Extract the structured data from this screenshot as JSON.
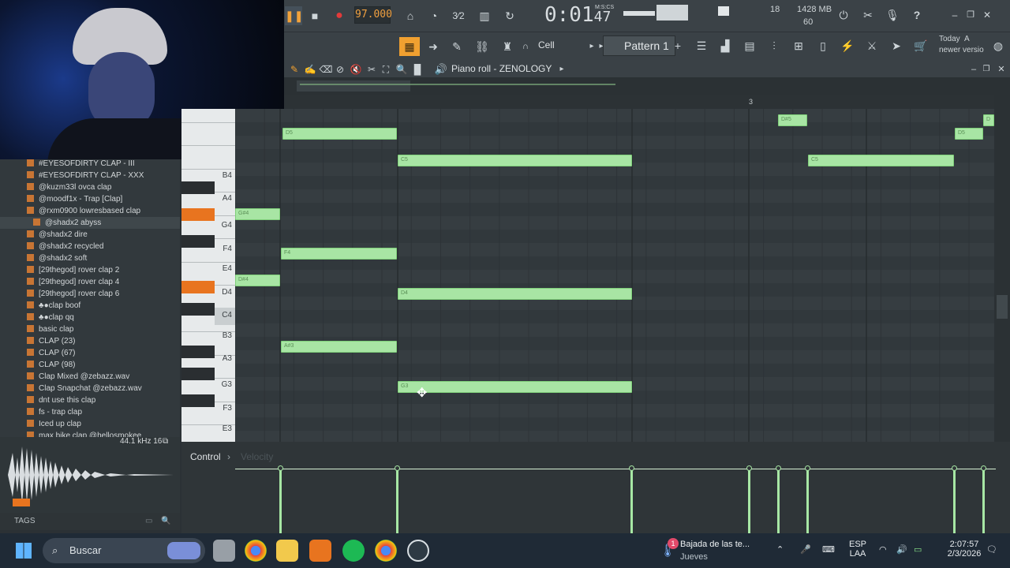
{
  "toolbar": {
    "tempo": "97.000",
    "time_main": "0:01",
    "time_sub": "47",
    "time_unit": "M:S:CS",
    "cpu": "18",
    "memory": "1428 MB",
    "polyphony": "60",
    "snap_label": "Cell",
    "pattern_label": "Pattern 1",
    "pattern_add": "+",
    "hint_today": "Today",
    "hint_msg": "newer versio",
    "hint_a": "A"
  },
  "piano_roll": {
    "title": "Piano roll - ZENOLOGY",
    "ruler_mark": "3",
    "keys": [
      "B4",
      "A4",
      "G4",
      "F4",
      "E4",
      "D4",
      "C4",
      "B3",
      "A3",
      "G3",
      "F3",
      "E3"
    ],
    "notes": [
      {
        "label": "D5"
      },
      {
        "label": "C5"
      },
      {
        "label": "D#5"
      },
      {
        "label": "C5"
      },
      {
        "label": "D5"
      },
      {
        "label": "D"
      },
      {
        "label": "G#4"
      },
      {
        "label": "F4"
      },
      {
        "label": "D#4"
      },
      {
        "label": "D4"
      },
      {
        "label": "A#3"
      },
      {
        "label": "G3"
      }
    ]
  },
  "control": {
    "label": "Control",
    "arrow": "›",
    "velocity_label": "Velocity"
  },
  "browser": {
    "items": [
      "#EYESOFDIRTY CLAP - III",
      "#EYESOFDIRTY CLAP - XXX",
      "@kuzm33l ovca clap",
      "@moodf1x - Trap [Clap]",
      "@rxm0900 lowresbased clap",
      "@shadx2 abyss",
      "@shadx2 dire",
      "@shadx2 recycled",
      "@shadx2 soft",
      "[29thegod] rover clap 2",
      "[29thegod] rover clap 4",
      "[29thegod] rover clap 6",
      "♣●clap boof",
      "♣●clap qq",
      "basic clap",
      "CLAP (23)",
      "CLAP (67)",
      "CLAP (98)",
      "Clap Mixed @zebazz.wav",
      "Clap Snapchat @zebazz.wav",
      "dnt use this clap",
      "fs - trap clap",
      "Iced up clap",
      "max bike clap @hellosmokee"
    ],
    "selected_index": 5,
    "sample_info": "44.1 kHz 16",
    "tags_label": "TAGS"
  },
  "taskbar": {
    "search_placeholder": "Buscar",
    "news_title": "Bajada de las te...",
    "news_sub": "Jueves",
    "news_badge": "1",
    "lang_top": "ESP",
    "lang_bottom": "LAA",
    "clock_time": "2:07:57",
    "clock_date": "2/3/2026"
  },
  "colors": {
    "note": "#a8e5a4",
    "accent": "#e8741f",
    "bg": "#353c40"
  }
}
